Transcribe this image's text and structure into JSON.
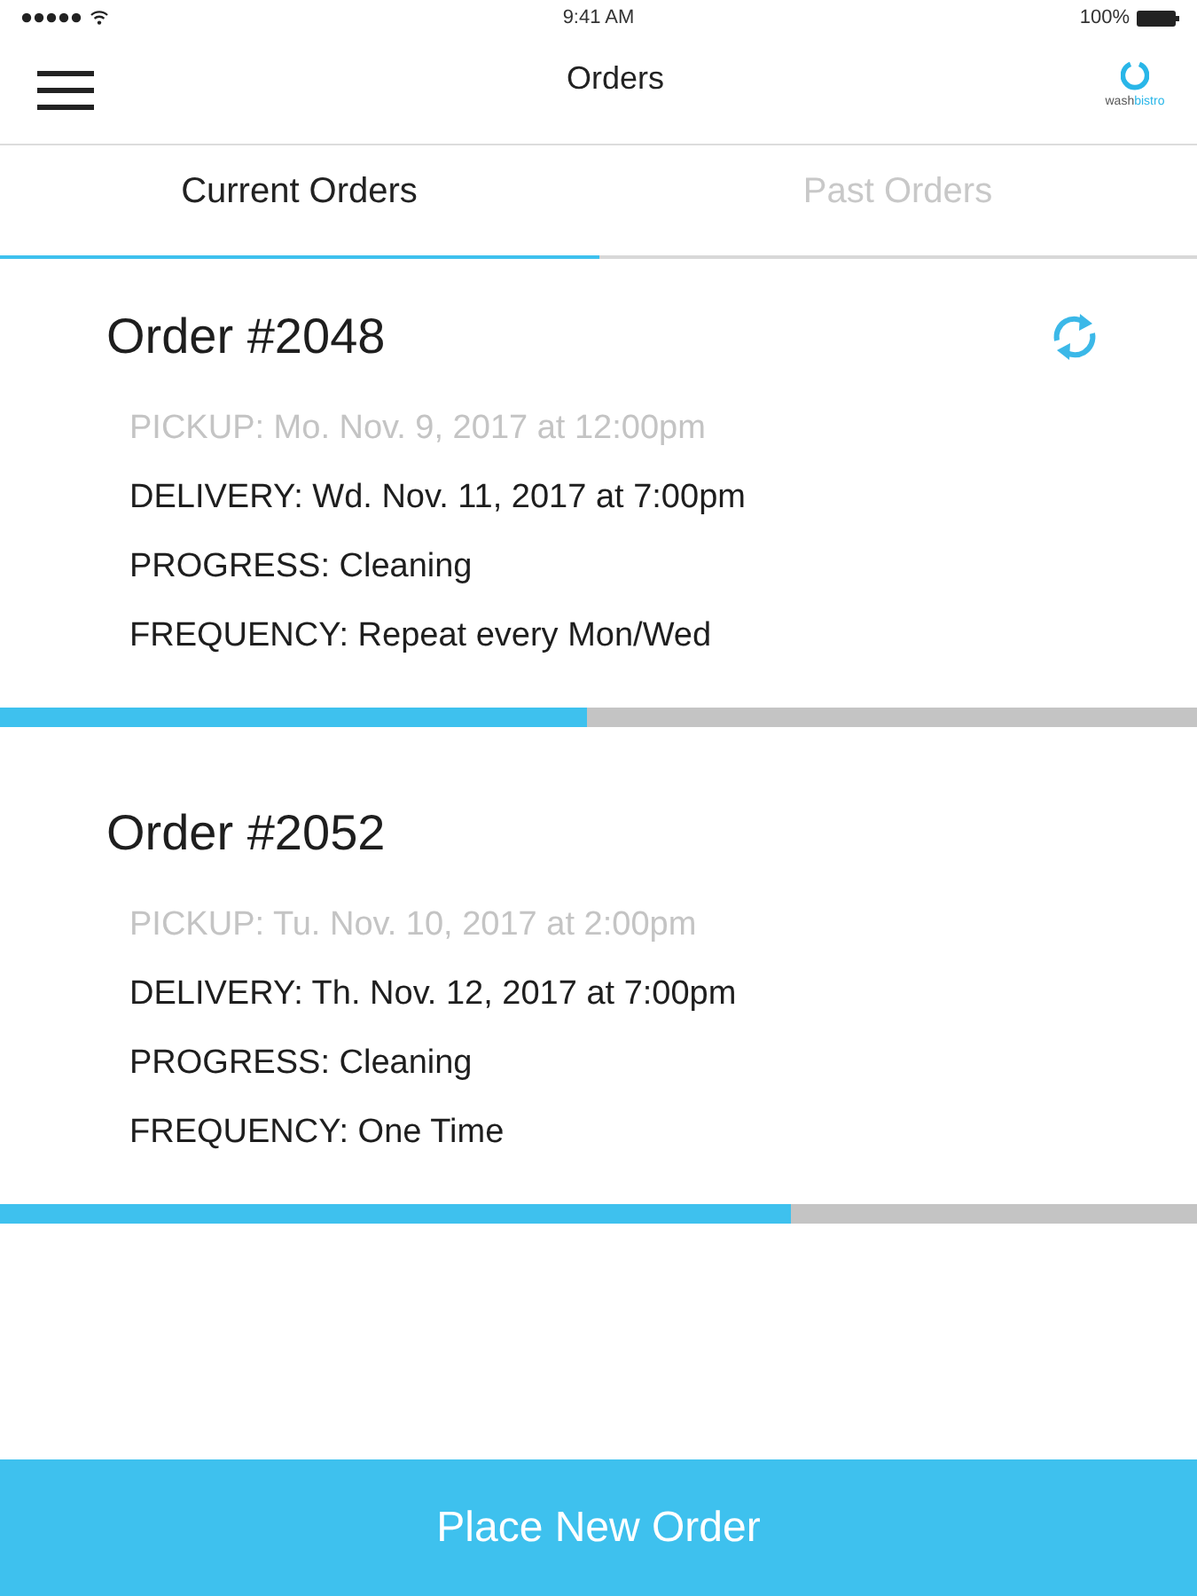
{
  "status_bar": {
    "time": "9:41 AM",
    "battery": "100%"
  },
  "nav_bar": {
    "title": "Orders",
    "logo": {
      "text": "wash",
      "accent_text": "bistro"
    }
  },
  "tabs": [
    {
      "label": "Current Orders",
      "selected": true
    },
    {
      "label": "Past Orders",
      "selected": false
    }
  ],
  "orders": [
    {
      "title": "Order #2048",
      "recurring": true,
      "details": [
        {
          "text": "PICKUP: Mo. Nov. 9, 2017 at 12:00pm",
          "done": true
        },
        {
          "text": "DELIVERY: Wd. Nov. 11, 2017 at 7:00pm",
          "done": false
        },
        {
          "text": "PROGRESS: Cleaning",
          "done": false
        },
        {
          "text": "FREQUENCY: Repeat every Mon/Wed",
          "done": false
        }
      ],
      "level": 0.49
    },
    {
      "title": "Order #2052",
      "recurring": false,
      "details": [
        {
          "text": "PICKUP: Tu. Nov. 10, 2017 at 2:00pm",
          "done": true
        },
        {
          "text": "DELIVERY: Th. Nov. 12, 2017 at 7:00pm",
          "done": false
        },
        {
          "text": "PROGRESS: Cleaning",
          "done": false
        },
        {
          "text": "FREQUENCY: One Time",
          "done": false
        }
      ],
      "level": 0.66
    }
  ],
  "primary_button": {
    "label": "Place New Order"
  }
}
